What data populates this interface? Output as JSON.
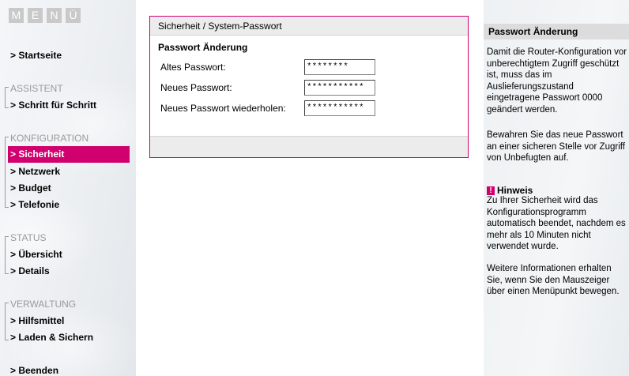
{
  "menu_letters": [
    "M",
    "E",
    "N",
    "Ü"
  ],
  "nav": {
    "startseite": "> Startseite",
    "assistent": "ASSISTENT",
    "schritt": "> Schritt für Schritt",
    "konfiguration": "KONFIGURATION",
    "sicherheit": "> Sicherheit",
    "netzwerk": "> Netzwerk",
    "budget": "> Budget",
    "telefonie": "> Telefonie",
    "status": "STATUS",
    "uebersicht": "> Übersicht",
    "details": "> Details",
    "verwaltung": "VERWALTUNG",
    "hilfsmittel": "> Hilfsmittel",
    "laden": "> Laden & Sichern",
    "beenden": "> Beenden"
  },
  "panel": {
    "breadcrumb": "Sicherheit / System-Passwort",
    "section_title": "Passwort Änderung",
    "fields": [
      {
        "label": "Altes Passwort:",
        "value": "********"
      },
      {
        "label": "Neues Passwort:",
        "value": "***********"
      },
      {
        "label": "Neues Passwort wiederholen:",
        "value": "***********"
      }
    ]
  },
  "help": {
    "title": "Passwort Änderung",
    "p1": "Damit die Router-Konfiguration vor unberechtigtem Zugriff geschützt ist, muss das im Auslieferungszustand eingetragene Passwort 0000 geändert werden.",
    "p2": "Bewahren Sie das neue Passwort an einer sicheren Stelle vor Zugriff von Unbefugten auf.",
    "hint_icon": "!",
    "hint_title": "Hinweis",
    "hint_text": "Zu Ihrer Sicherheit wird das Konfigurationsprogramm automatisch beendet, nachdem es mehr als 10 Minuten nicht verwendet wurde.",
    "p3": "Weitere Informationen erhalten Sie, wenn Sie den Mauszeiger über einen Menüpunkt bewegen."
  },
  "colors": {
    "accent": "#d1006f",
    "section_gray": "#9a9a9a",
    "panel_bar": "#ececec"
  }
}
